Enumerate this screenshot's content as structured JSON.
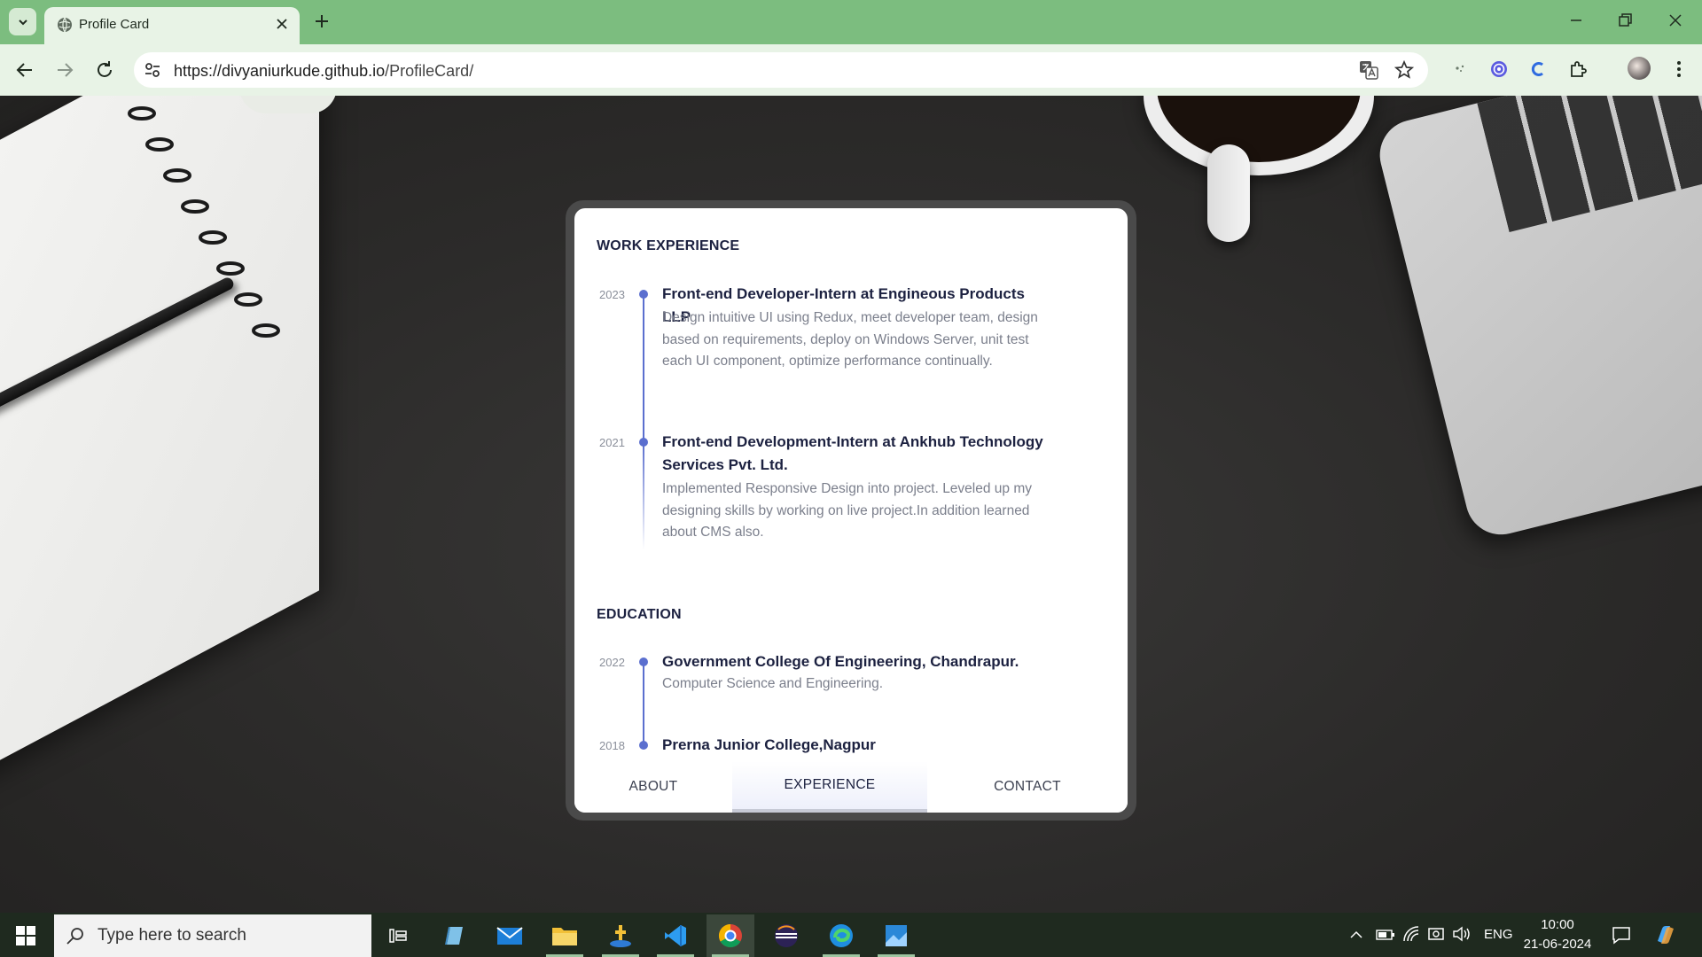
{
  "browser": {
    "tab_title": "Profile Card",
    "url_host": "https://divyaniurkude.github.io",
    "url_path": "/ProfileCard/"
  },
  "card": {
    "work_title": "WORK EXPERIENCE",
    "work": [
      {
        "year": "2023",
        "heading": "Front-end Developer-Intern at Engineous Products LLP",
        "desc": "Design intuitive UI using Redux, meet developer team, design based on requirements, deploy on Windows Server, unit test each UI component, optimize performance continually."
      },
      {
        "year": "2021",
        "heading": "Front-end Development-Intern at Ankhub Technology Services Pvt. Ltd.",
        "desc": "Implemented Responsive Design into project. Leveled up my designing skills by working on live project.In addition learned about CMS also."
      }
    ],
    "education_title": "EDUCATION",
    "education": [
      {
        "year": "2022",
        "heading": "Government College Of Engineering, Chandrapur.",
        "desc": "Computer Science and Engineering."
      },
      {
        "year": "2018",
        "heading": "Prerna Junior College,Nagpur"
      }
    ],
    "tabs": [
      "ABOUT",
      "EXPERIENCE",
      "CONTACT"
    ],
    "active_tab": "EXPERIENCE",
    "accent_color": "#5b6fcf"
  },
  "taskbar": {
    "search_placeholder": "Type here to search",
    "language": "ENG",
    "time": "10:00",
    "date": "21-06-2024"
  }
}
